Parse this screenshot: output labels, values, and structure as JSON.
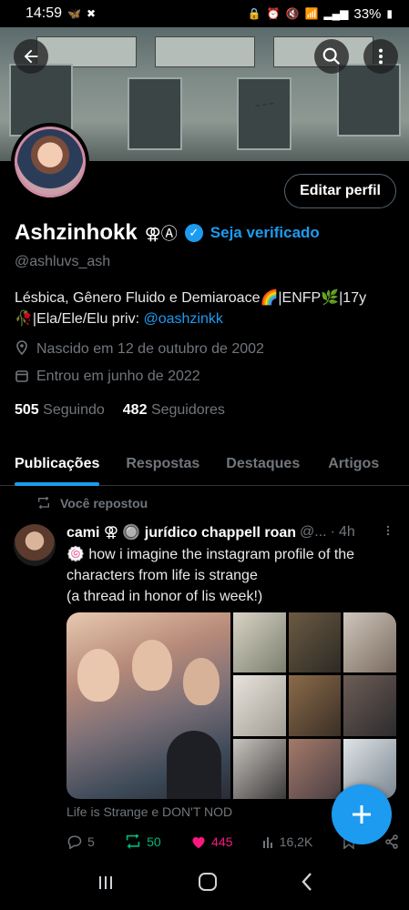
{
  "status_bar": {
    "time": "14:59",
    "battery": "33%",
    "left_icons": [
      "butterfly-icon",
      "x-logo-icon"
    ],
    "right_icons": [
      "lock-icon",
      "alarm-icon",
      "mute-icon",
      "wifi-icon",
      "volte-icon",
      "signal-icon",
      "battery-icon"
    ]
  },
  "header": {
    "back_icon": "back-arrow-icon",
    "search_icon": "search-icon",
    "more_icon": "more-vertical-icon",
    "edit_profile_label": "Editar perfil"
  },
  "profile": {
    "name": "Ashzinhokk",
    "name_symbols": "⚢Ⓐ",
    "get_verified_label": "Seja verificado",
    "handle": "@ashluvs_ash",
    "bio_line1": "Lésbica, Gênero Fluido e Demiaroace🌈|ENFP🌿|17y",
    "bio_line2_prefix": "🥀|Ela/Ele/Elu priv: ",
    "bio_mention": "@oashzinkk",
    "birth": "Nascido em 12 de outubro de 2002",
    "joined": "Entrou em junho de 2022",
    "following_count": "505",
    "following_label": "Seguindo",
    "followers_count": "482",
    "followers_label": "Seguidores"
  },
  "tabs": [
    {
      "label": "Publicações",
      "active": true
    },
    {
      "label": "Respostas",
      "active": false
    },
    {
      "label": "Destaques",
      "active": false
    },
    {
      "label": "Artigos",
      "active": false
    }
  ],
  "post": {
    "repost_label": "Você repostou",
    "author": "cami ⚢ 🔘 jurídico chappell roan",
    "handle_trunc": "@...",
    "time": "4h",
    "text_line1": "🍥 how i imagine the instagram profile of the",
    "text_line2": "characters from life is strange",
    "text_line3": "(a thread in honor of lis week!)",
    "caption": "Life is Strange e DON'T NOD",
    "replies": "5",
    "reposts": "50",
    "likes": "445",
    "views": "16,2K"
  },
  "colors": {
    "accent": "#1d9bf0",
    "repost_green": "#00ba7c",
    "like_pink": "#f91880",
    "muted": "#71767b"
  },
  "nav": [
    "recents-icon",
    "home-icon",
    "back-icon"
  ]
}
